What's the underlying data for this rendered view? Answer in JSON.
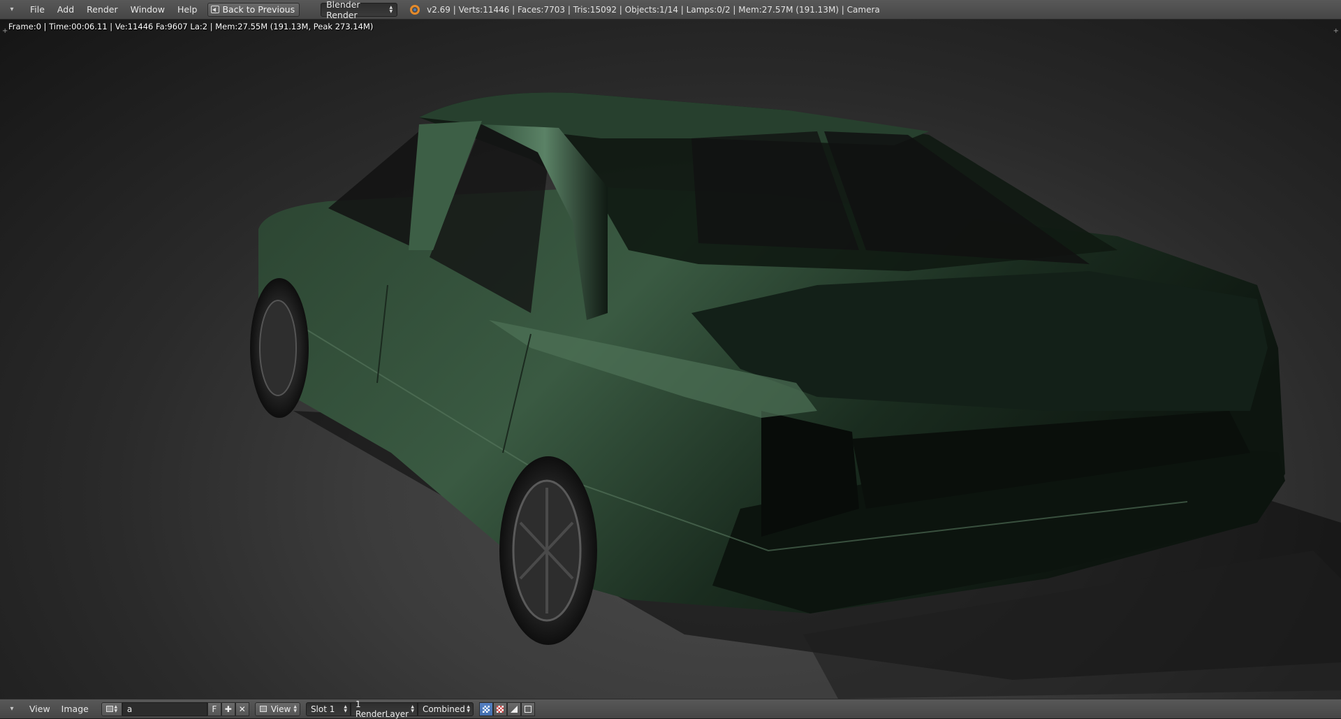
{
  "topbar": {
    "menu": [
      "File",
      "Add",
      "Render",
      "Window",
      "Help"
    ],
    "back_button": "Back to Previous",
    "render_engine": "Blender Render",
    "stats": "v2.69 | Verts:11446 | Faces:7703 | Tris:15092 | Objects:1/14 | Lamps:0/2 | Mem:27.57M (191.13M) | Camera"
  },
  "viewport": {
    "render_info": "Frame:0 | Time:00:06.11 | Ve:11446 Fa:9607 La:2 | Mem:27.55M (191.13M, Peak 273.14M)",
    "render_subject": "green sedan car body render"
  },
  "bottombar": {
    "menu": [
      "View",
      "Image"
    ],
    "image_name": "a",
    "fake_user_label": "F",
    "view_label": "View",
    "slot": "Slot 1",
    "render_layer": "1 RenderLayer",
    "render_pass": "Combined"
  },
  "colors": {
    "header_bg": "#4f4f4f",
    "car_green": "#2f4a36",
    "viewport_bg": "#333333",
    "active_toggle": "#5680c2"
  }
}
